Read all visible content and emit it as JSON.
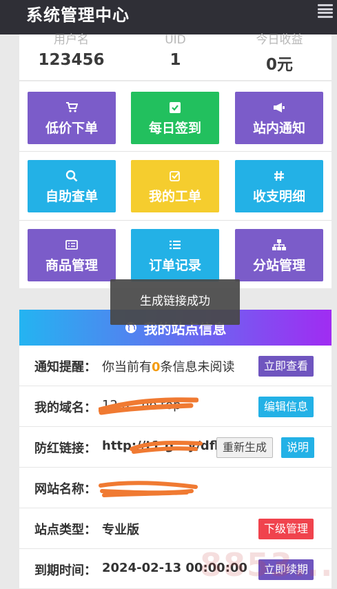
{
  "header": {
    "title": "系统管理中心",
    "menu_icon": "hamburger-icon"
  },
  "stats": [
    {
      "label": "用户名",
      "value": "123456"
    },
    {
      "label": "UID",
      "value": "1"
    },
    {
      "label": "今日收益",
      "value": "0元"
    }
  ],
  "tiles": [
    {
      "label": "低价下单",
      "icon": "cart-icon",
      "color": "#7b5cc9"
    },
    {
      "label": "每日签到",
      "icon": "checkbox-icon",
      "color": "#22c05e"
    },
    {
      "label": "站内通知",
      "icon": "bullhorn-icon",
      "color": "#7b5cc9"
    },
    {
      "label": "自助查单",
      "icon": "search-icon",
      "color": "#23b1e6"
    },
    {
      "label": "我的工单",
      "icon": "check-square-icon",
      "color": "#f5cd2e"
    },
    {
      "label": "收支明细",
      "icon": "hashtag-icon",
      "color": "#23b1e6"
    },
    {
      "label": "商品管理",
      "icon": "list-alt-icon",
      "color": "#7b5cc9"
    },
    {
      "label": "订单记录",
      "icon": "list-icon",
      "color": "#23b1e6"
    },
    {
      "label": "分站管理",
      "icon": "sitemap-icon",
      "color": "#7b5cc9"
    }
  ],
  "toast": {
    "text": "生成链接成功"
  },
  "site_info": {
    "title": "我的站点信息",
    "notice": {
      "label": "通知提醒：",
      "prefix": "你当前有",
      "count": "0",
      "suffix": "条信息未阅读",
      "button": "立即查看"
    },
    "domain": {
      "label": "我的域名：",
      "value": "12.g...ho.top",
      "button": "编辑信息"
    },
    "antired": {
      "label": "防红链接：",
      "value": "http://t1.g...y/dfl",
      "button_regen": "重新生成",
      "button_help": "说明"
    },
    "site_name": {
      "label": "网站名称：",
      "value": ""
    },
    "site_type": {
      "label": "站点类型：",
      "value": "专业版",
      "button": "下级管理"
    },
    "expire": {
      "label": "到期时间：",
      "value": "2024-02-13 00:00:00",
      "button": "立即续期"
    }
  },
  "watermark": "8853..."
}
